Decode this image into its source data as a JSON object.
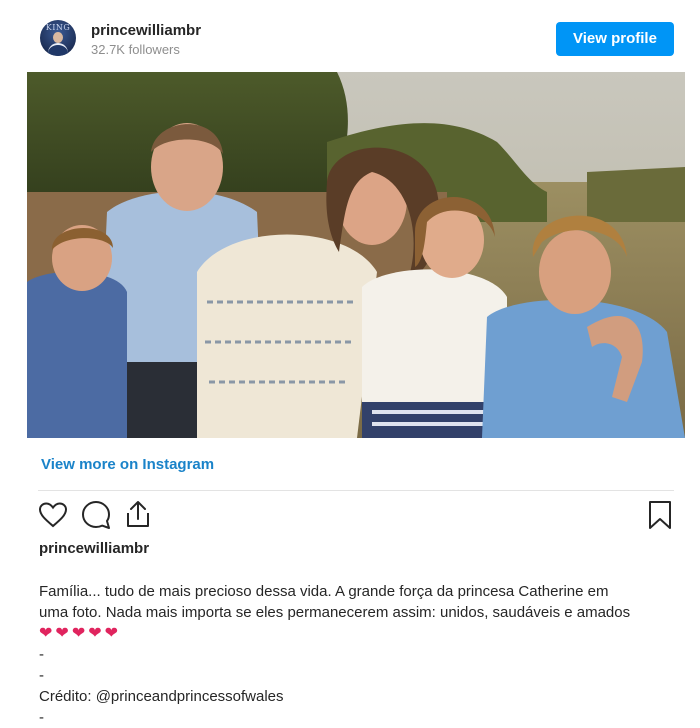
{
  "profile": {
    "username": "princewilliambr",
    "followers": "32.7K followers",
    "avatar_text": "KING",
    "view_profile_label": "View profile"
  },
  "post": {
    "image_alt": "Prince William, Princess Catherine and their three children smiling outdoors",
    "view_more_label": "View more on Instagram",
    "icons": {
      "like": "heart-icon",
      "comment": "comment-icon",
      "share": "share-icon",
      "save": "bookmark-icon"
    },
    "username": "princewilliambr",
    "caption_line1": "Família... tudo de mais precioso dessa vida. A grande força da princesa Catherine em",
    "caption_line2": "uma foto. Nada mais importa se eles permanecerem assim: unidos, saudáveis e amados",
    "hearts": "❤❤❤❤❤",
    "dash1": "-",
    "dash2": "-",
    "credit_prefix": "Crédito: ",
    "credit_handle": "@princeandprincessofwales",
    "dash3": "-"
  },
  "colors": {
    "primary_button": "#0095f6",
    "link": "#1a83c9",
    "heart": "#e0245e"
  }
}
